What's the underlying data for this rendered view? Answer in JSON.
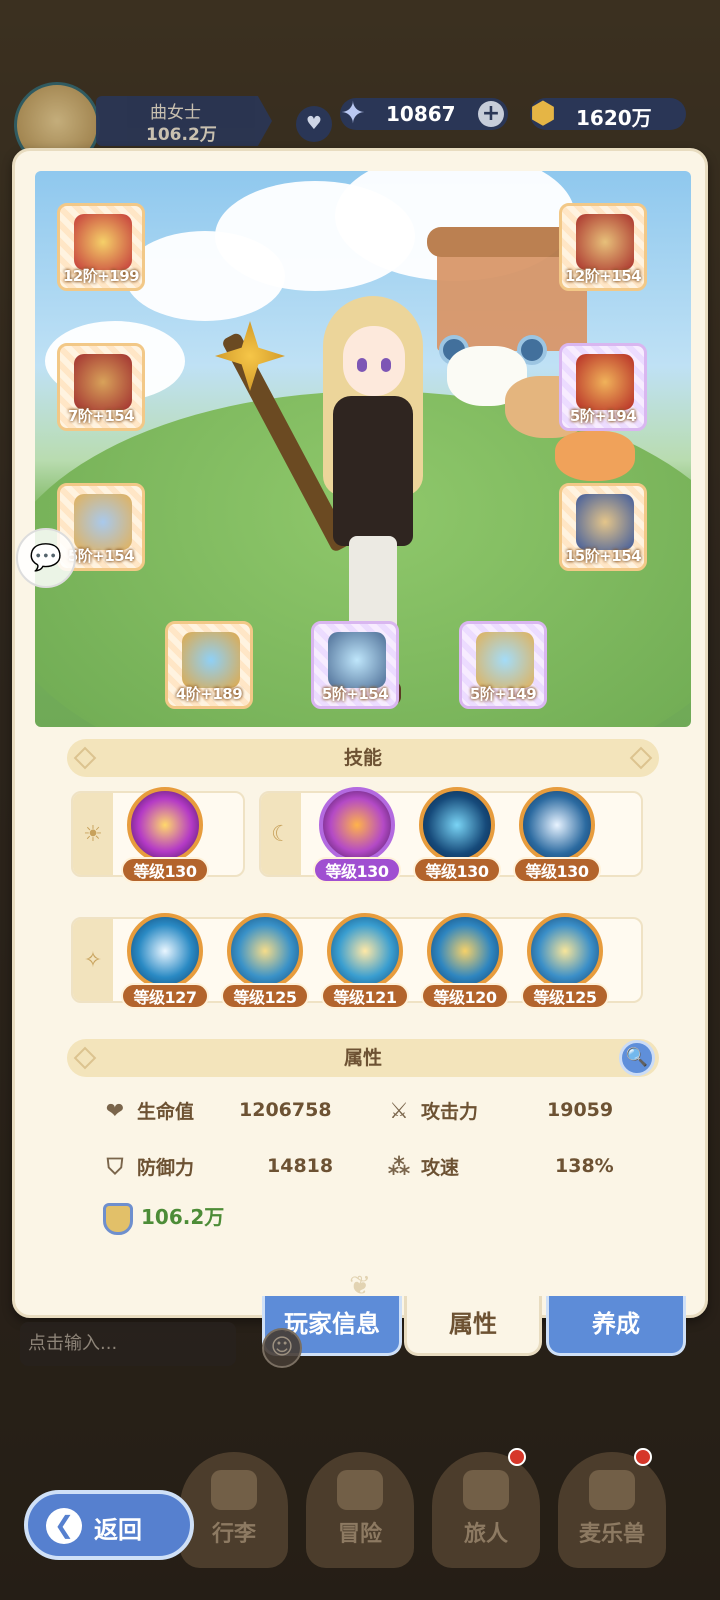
{
  "topbar": {
    "player_name": "曲女士",
    "player_power": "106.2万",
    "gems": "10867",
    "gold": "1620万"
  },
  "equipment": [
    {
      "name": "staff-weapon",
      "label": "12阶+199",
      "rarity": "orange"
    },
    {
      "name": "helmet",
      "label": "12阶+154",
      "rarity": "orange"
    },
    {
      "name": "chest-armor",
      "label": "7阶+154",
      "rarity": "orange"
    },
    {
      "name": "gauntlet",
      "label": "5阶+194",
      "rarity": "purple"
    },
    {
      "name": "leg-armor",
      "label": "5阶+154",
      "rarity": "orange"
    },
    {
      "name": "boots",
      "label": "15阶+154",
      "rarity": "orange"
    },
    {
      "name": "ring",
      "label": "4阶+189",
      "rarity": "orange"
    },
    {
      "name": "necklace",
      "label": "5阶+154",
      "rarity": "purple"
    },
    {
      "name": "amulet",
      "label": "5阶+149",
      "rarity": "purple"
    }
  ],
  "skills": {
    "section_title": "技能",
    "row1_left": [
      {
        "label": "等级130"
      }
    ],
    "row1_right": [
      {
        "label": "等级130"
      },
      {
        "label": "等级130"
      },
      {
        "label": "等级130"
      }
    ],
    "row2": [
      {
        "label": "等级127"
      },
      {
        "label": "等级125"
      },
      {
        "label": "等级121"
      },
      {
        "label": "等级120"
      },
      {
        "label": "等级125"
      }
    ]
  },
  "attributes": {
    "section_title": "属性",
    "hp_label": "生命值",
    "hp_value": "1206758",
    "atk_label": "攻击力",
    "atk_value": "19059",
    "def_label": "防御力",
    "def_value": "14818",
    "spd_label": "攻速",
    "spd_value": "138%",
    "power": "106.2万"
  },
  "tabs": {
    "player_info": "玩家信息",
    "attributes": "属性",
    "develop": "养成"
  },
  "chat": {
    "placeholder": "点击输入..."
  },
  "nav": {
    "back": "返回",
    "bag": "行李",
    "adventure": "冒险",
    "traveler": "旅人",
    "pet": "麦乐兽"
  },
  "colors": {
    "accent_blue": "#5d8cd8",
    "panel_bg": "#fbf5e6",
    "level_brown": "#b3642c",
    "purple": "#a04fd1",
    "power_green": "#4d8c37"
  }
}
